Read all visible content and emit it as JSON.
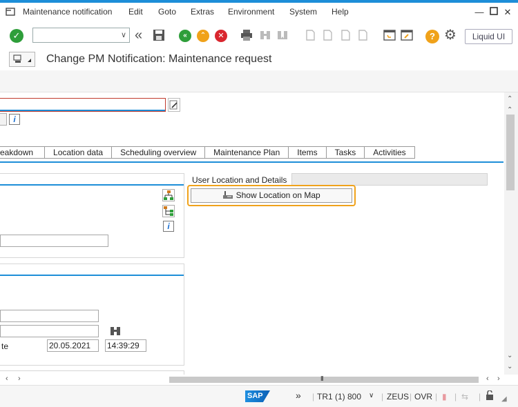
{
  "menu": {
    "items": [
      "Maintenance notification",
      "Edit",
      "Goto",
      "Extras",
      "Environment",
      "System",
      "Help"
    ]
  },
  "toolbar": {
    "liquid_label": "Liquid UI"
  },
  "title": "Change PM Notification: Maintenance request",
  "tabs": [
    "eakdown",
    "Location data",
    "Scheduling overview",
    "Maintenance Plan",
    "Items",
    "Tasks",
    "Activities"
  ],
  "location": {
    "label": "User Location and Details",
    "button_label": "Show Location on Map"
  },
  "dates": {
    "label_fragment": "te",
    "date": "20.05.2021",
    "time": "14:39:29"
  },
  "status": {
    "system": "TR1 (1) 800",
    "server": "ZEUS",
    "mode": "OVR"
  },
  "colors": {
    "accent": "#1d8ed8",
    "highlight": "#f0a21a"
  }
}
